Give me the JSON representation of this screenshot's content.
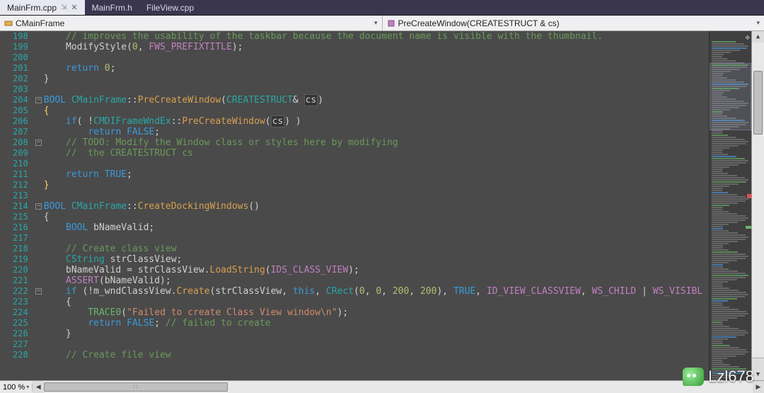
{
  "tabs": [
    {
      "label": "MainFrm.cpp",
      "active": true
    },
    {
      "label": "MainFrm.h",
      "active": false
    },
    {
      "label": "FileView.cpp",
      "active": false
    }
  ],
  "nav": {
    "left": "CMainFrame",
    "right": "PreCreateWindow(CREATESTRUCT & cs)"
  },
  "zoom": "100 %",
  "first_line": 198,
  "code_lines": [
    {
      "outline": "",
      "segs": [
        [
          "    ",
          ""
        ],
        [
          "// improves the usability of the taskbar because the document name is visible with the thumbnail.",
          "c-cmt"
        ]
      ]
    },
    {
      "outline": "",
      "segs": [
        [
          "    ",
          ""
        ],
        [
          "ModifyStyle",
          ""
        ],
        [
          "(",
          ""
        ],
        [
          "0",
          "c-num"
        ],
        [
          ", ",
          ""
        ],
        [
          "FWS_PREFIXTITLE",
          "c-def"
        ],
        [
          ");",
          ""
        ]
      ]
    },
    {
      "outline": "",
      "segs": [
        [
          "",
          ""
        ]
      ]
    },
    {
      "outline": "",
      "segs": [
        [
          "    ",
          ""
        ],
        [
          "return",
          "c-kw"
        ],
        [
          " ",
          ""
        ],
        [
          "0",
          "c-num"
        ],
        [
          ";",
          ""
        ]
      ]
    },
    {
      "outline": "",
      "segs": [
        [
          "}",
          ""
        ]
      ]
    },
    {
      "outline": "",
      "segs": [
        [
          "",
          ""
        ]
      ]
    },
    {
      "outline": "box",
      "segs": [
        [
          "BOOL",
          "c-type"
        ],
        [
          " ",
          ""
        ],
        [
          "CMainFrame",
          "c-cls"
        ],
        [
          "::",
          ""
        ],
        [
          "PreCreateWindow",
          "c-fn"
        ],
        [
          "(",
          ""
        ],
        [
          "CREATESTRUCT",
          "c-cls"
        ],
        [
          "& ",
          ""
        ],
        [
          "cs",
          "c-hl"
        ],
        [
          ")",
          ""
        ]
      ]
    },
    {
      "outline": "",
      "segs": [
        [
          "{",
          "c-gold"
        ]
      ]
    },
    {
      "outline": "",
      "segs": [
        [
          "    ",
          ""
        ],
        [
          "if",
          "c-kw"
        ],
        [
          "( !",
          ""
        ],
        [
          "CMDIFrameWndEx",
          "c-cls"
        ],
        [
          "::",
          ""
        ],
        [
          "PreCreateWindow",
          "c-fn"
        ],
        [
          "(",
          ""
        ],
        [
          "cs",
          "c-hl"
        ],
        [
          ") )",
          ""
        ]
      ]
    },
    {
      "outline": "",
      "segs": [
        [
          "        ",
          ""
        ],
        [
          "return",
          "c-kw"
        ],
        [
          " ",
          ""
        ],
        [
          "FALSE",
          "c-kw"
        ],
        [
          ";",
          ""
        ]
      ]
    },
    {
      "outline": "box",
      "segs": [
        [
          "    ",
          ""
        ],
        [
          "// TODO: Modify the Window class or styles here by modifying",
          "c-cmt"
        ]
      ]
    },
    {
      "outline": "",
      "segs": [
        [
          "    ",
          ""
        ],
        [
          "//  the CREATESTRUCT cs",
          "c-cmt"
        ]
      ]
    },
    {
      "outline": "",
      "segs": [
        [
          "",
          ""
        ]
      ]
    },
    {
      "outline": "",
      "segs": [
        [
          "    ",
          ""
        ],
        [
          "return",
          "c-kw"
        ],
        [
          " ",
          ""
        ],
        [
          "TRUE",
          "c-kw"
        ],
        [
          ";",
          ""
        ]
      ]
    },
    {
      "outline": "",
      "segs": [
        [
          "}",
          "c-gold"
        ]
      ]
    },
    {
      "outline": "",
      "segs": [
        [
          "",
          ""
        ]
      ]
    },
    {
      "outline": "box",
      "segs": [
        [
          "BOOL",
          "c-type"
        ],
        [
          " ",
          ""
        ],
        [
          "CMainFrame",
          "c-cls"
        ],
        [
          "::",
          ""
        ],
        [
          "CreateDockingWindows",
          "c-fn"
        ],
        [
          "()",
          ""
        ]
      ]
    },
    {
      "outline": "",
      "segs": [
        [
          "{",
          ""
        ]
      ]
    },
    {
      "outline": "",
      "segs": [
        [
          "    ",
          ""
        ],
        [
          "BOOL",
          "c-type"
        ],
        [
          " bNameValid;",
          ""
        ]
      ]
    },
    {
      "outline": "",
      "segs": [
        [
          "",
          ""
        ]
      ]
    },
    {
      "outline": "",
      "segs": [
        [
          "    ",
          ""
        ],
        [
          "// Create class view",
          "c-cmt"
        ]
      ]
    },
    {
      "outline": "",
      "segs": [
        [
          "    ",
          ""
        ],
        [
          "CString",
          "c-cls"
        ],
        [
          " strClassView;",
          ""
        ]
      ]
    },
    {
      "outline": "",
      "segs": [
        [
          "    bNameValid = strClassView.",
          ""
        ],
        [
          "LoadString",
          "c-fn"
        ],
        [
          "(",
          ""
        ],
        [
          "IDS_CLASS_VIEW",
          "c-def"
        ],
        [
          ");",
          ""
        ]
      ]
    },
    {
      "outline": "",
      "segs": [
        [
          "    ",
          ""
        ],
        [
          "ASSERT",
          "c-def"
        ],
        [
          "(bNameValid);",
          ""
        ]
      ]
    },
    {
      "outline": "box",
      "segs": [
        [
          "    ",
          ""
        ],
        [
          "if",
          "c-kw"
        ],
        [
          " (!m_wndClassView.",
          ""
        ],
        [
          "Create",
          "c-fn"
        ],
        [
          "(strClassView, ",
          ""
        ],
        [
          "this",
          "c-kw"
        ],
        [
          ", ",
          ""
        ],
        [
          "CRect",
          "c-cls"
        ],
        [
          "(",
          ""
        ],
        [
          "0",
          "c-num"
        ],
        [
          ", ",
          ""
        ],
        [
          "0",
          "c-num"
        ],
        [
          ", ",
          ""
        ],
        [
          "200",
          "c-num"
        ],
        [
          ", ",
          ""
        ],
        [
          "200",
          "c-num"
        ],
        [
          "), ",
          ""
        ],
        [
          "TRUE",
          "c-kw"
        ],
        [
          ", ",
          ""
        ],
        [
          "ID_VIEW_CLASSVIEW",
          "c-def"
        ],
        [
          ", ",
          ""
        ],
        [
          "WS_CHILD",
          "c-def"
        ],
        [
          " | ",
          ""
        ],
        [
          "WS_VISIBL",
          "c-def"
        ]
      ]
    },
    {
      "outline": "",
      "segs": [
        [
          "    {",
          ""
        ]
      ]
    },
    {
      "outline": "",
      "segs": [
        [
          "        ",
          ""
        ],
        [
          "TRACE0",
          "c-green"
        ],
        [
          "(",
          ""
        ],
        [
          "\"Failed to create Class View window\\n\"",
          "c-str"
        ],
        [
          ");",
          ""
        ]
      ]
    },
    {
      "outline": "",
      "segs": [
        [
          "        ",
          ""
        ],
        [
          "return",
          "c-kw"
        ],
        [
          " ",
          ""
        ],
        [
          "FALSE",
          "c-kw"
        ],
        [
          "; ",
          ""
        ],
        [
          "// failed to create",
          "c-cmt"
        ]
      ]
    },
    {
      "outline": "",
      "segs": [
        [
          "    }",
          ""
        ]
      ]
    },
    {
      "outline": "",
      "segs": [
        [
          "",
          ""
        ]
      ]
    },
    {
      "outline": "",
      "segs": [
        [
          "    ",
          ""
        ],
        [
          "// Create file view",
          "c-cmt"
        ]
      ]
    }
  ],
  "watermark": "Lzl678"
}
